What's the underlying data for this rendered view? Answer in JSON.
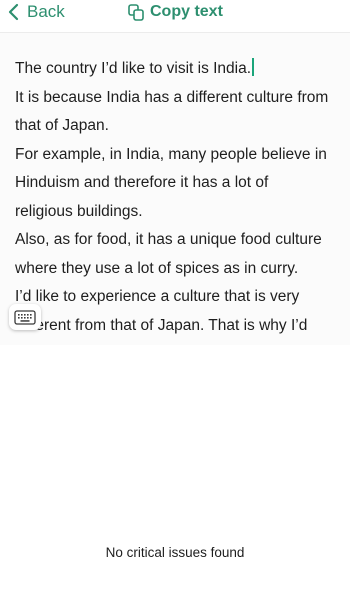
{
  "nav": {
    "back_label": "Back",
    "copy_label": "Copy text",
    "accent_color": "#2d8f6f"
  },
  "editor": {
    "lines": [
      "The country I’d like to visit is India.",
      "It is because India has a different culture from",
      "that of Japan.",
      "For example, in India, many people believe in",
      "Hinduism and therefore it has a lot of",
      "religious buildings.",
      "Also, as for food, it has a unique food culture",
      "where they use a lot of spices as in curry.",
      "I’d like to experience a culture that is very",
      "different from that of Japan. That is why I’d"
    ],
    "caret_color": "#1aa57a"
  },
  "keyboard_button": {
    "icon": "keyboard-icon"
  },
  "status": {
    "text": "No critical issues found"
  }
}
